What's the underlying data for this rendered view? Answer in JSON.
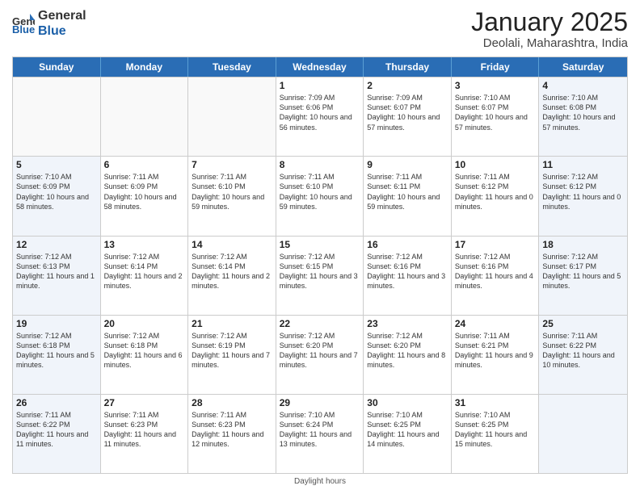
{
  "header": {
    "logo_general": "General",
    "logo_blue": "Blue",
    "title": "January 2025",
    "subtitle": "Deolali, Maharashtra, India"
  },
  "days_of_week": [
    "Sunday",
    "Monday",
    "Tuesday",
    "Wednesday",
    "Thursday",
    "Friday",
    "Saturday"
  ],
  "weeks": [
    {
      "cells": [
        {
          "day": null,
          "shaded": false
        },
        {
          "day": null,
          "shaded": false
        },
        {
          "day": null,
          "shaded": false
        },
        {
          "day": "1",
          "shaded": false,
          "sunrise": "7:09 AM",
          "sunset": "6:06 PM",
          "daylight": "10 hours and 56 minutes."
        },
        {
          "day": "2",
          "shaded": false,
          "sunrise": "7:09 AM",
          "sunset": "6:07 PM",
          "daylight": "10 hours and 57 minutes."
        },
        {
          "day": "3",
          "shaded": false,
          "sunrise": "7:10 AM",
          "sunset": "6:07 PM",
          "daylight": "10 hours and 57 minutes."
        },
        {
          "day": "4",
          "shaded": true,
          "sunrise": "7:10 AM",
          "sunset": "6:08 PM",
          "daylight": "10 hours and 57 minutes."
        }
      ]
    },
    {
      "cells": [
        {
          "day": "5",
          "shaded": true,
          "sunrise": "7:10 AM",
          "sunset": "6:09 PM",
          "daylight": "10 hours and 58 minutes."
        },
        {
          "day": "6",
          "shaded": false,
          "sunrise": "7:11 AM",
          "sunset": "6:09 PM",
          "daylight": "10 hours and 58 minutes."
        },
        {
          "day": "7",
          "shaded": false,
          "sunrise": "7:11 AM",
          "sunset": "6:10 PM",
          "daylight": "10 hours and 59 minutes."
        },
        {
          "day": "8",
          "shaded": false,
          "sunrise": "7:11 AM",
          "sunset": "6:10 PM",
          "daylight": "10 hours and 59 minutes."
        },
        {
          "day": "9",
          "shaded": false,
          "sunrise": "7:11 AM",
          "sunset": "6:11 PM",
          "daylight": "10 hours and 59 minutes."
        },
        {
          "day": "10",
          "shaded": false,
          "sunrise": "7:11 AM",
          "sunset": "6:12 PM",
          "daylight": "11 hours and 0 minutes."
        },
        {
          "day": "11",
          "shaded": true,
          "sunrise": "7:12 AM",
          "sunset": "6:12 PM",
          "daylight": "11 hours and 0 minutes."
        }
      ]
    },
    {
      "cells": [
        {
          "day": "12",
          "shaded": true,
          "sunrise": "7:12 AM",
          "sunset": "6:13 PM",
          "daylight": "11 hours and 1 minute."
        },
        {
          "day": "13",
          "shaded": false,
          "sunrise": "7:12 AM",
          "sunset": "6:14 PM",
          "daylight": "11 hours and 2 minutes."
        },
        {
          "day": "14",
          "shaded": false,
          "sunrise": "7:12 AM",
          "sunset": "6:14 PM",
          "daylight": "11 hours and 2 minutes."
        },
        {
          "day": "15",
          "shaded": false,
          "sunrise": "7:12 AM",
          "sunset": "6:15 PM",
          "daylight": "11 hours and 3 minutes."
        },
        {
          "day": "16",
          "shaded": false,
          "sunrise": "7:12 AM",
          "sunset": "6:16 PM",
          "daylight": "11 hours and 3 minutes."
        },
        {
          "day": "17",
          "shaded": false,
          "sunrise": "7:12 AM",
          "sunset": "6:16 PM",
          "daylight": "11 hours and 4 minutes."
        },
        {
          "day": "18",
          "shaded": true,
          "sunrise": "7:12 AM",
          "sunset": "6:17 PM",
          "daylight": "11 hours and 5 minutes."
        }
      ]
    },
    {
      "cells": [
        {
          "day": "19",
          "shaded": true,
          "sunrise": "7:12 AM",
          "sunset": "6:18 PM",
          "daylight": "11 hours and 5 minutes."
        },
        {
          "day": "20",
          "shaded": false,
          "sunrise": "7:12 AM",
          "sunset": "6:18 PM",
          "daylight": "11 hours and 6 minutes."
        },
        {
          "day": "21",
          "shaded": false,
          "sunrise": "7:12 AM",
          "sunset": "6:19 PM",
          "daylight": "11 hours and 7 minutes."
        },
        {
          "day": "22",
          "shaded": false,
          "sunrise": "7:12 AM",
          "sunset": "6:20 PM",
          "daylight": "11 hours and 7 minutes."
        },
        {
          "day": "23",
          "shaded": false,
          "sunrise": "7:12 AM",
          "sunset": "6:20 PM",
          "daylight": "11 hours and 8 minutes."
        },
        {
          "day": "24",
          "shaded": false,
          "sunrise": "7:11 AM",
          "sunset": "6:21 PM",
          "daylight": "11 hours and 9 minutes."
        },
        {
          "day": "25",
          "shaded": true,
          "sunrise": "7:11 AM",
          "sunset": "6:22 PM",
          "daylight": "11 hours and 10 minutes."
        }
      ]
    },
    {
      "cells": [
        {
          "day": "26",
          "shaded": true,
          "sunrise": "7:11 AM",
          "sunset": "6:22 PM",
          "daylight": "11 hours and 11 minutes."
        },
        {
          "day": "27",
          "shaded": false,
          "sunrise": "7:11 AM",
          "sunset": "6:23 PM",
          "daylight": "11 hours and 11 minutes."
        },
        {
          "day": "28",
          "shaded": false,
          "sunrise": "7:11 AM",
          "sunset": "6:23 PM",
          "daylight": "11 hours and 12 minutes."
        },
        {
          "day": "29",
          "shaded": false,
          "sunrise": "7:10 AM",
          "sunset": "6:24 PM",
          "daylight": "11 hours and 13 minutes."
        },
        {
          "day": "30",
          "shaded": false,
          "sunrise": "7:10 AM",
          "sunset": "6:25 PM",
          "daylight": "11 hours and 14 minutes."
        },
        {
          "day": "31",
          "shaded": false,
          "sunrise": "7:10 AM",
          "sunset": "6:25 PM",
          "daylight": "11 hours and 15 minutes."
        },
        {
          "day": null,
          "shaded": true
        }
      ]
    }
  ],
  "footer": {
    "note": "Daylight hours"
  }
}
